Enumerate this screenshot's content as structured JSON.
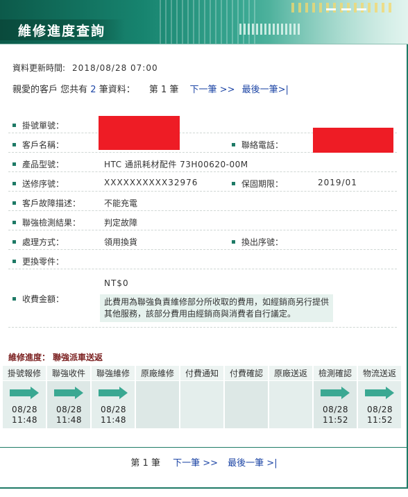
{
  "header": {
    "title": "維修進度查詢"
  },
  "update": {
    "label": "資料更新時間:",
    "value": "2018/08/28 07:00"
  },
  "summary": {
    "prefix": "親愛的客戶 您共有",
    "count": "2",
    "suffix": "筆資料：",
    "page": "第 1 筆",
    "next": "下一筆 >>",
    "last": "最後一筆>|"
  },
  "fields": {
    "ticket_no": {
      "label": "掛號單號："
    },
    "customer_name": {
      "label": "客戶名稱："
    },
    "phone": {
      "label": "聯絡電話："
    },
    "model": {
      "label": "產品型號：",
      "value": "HTC 通訊耗材配件 73H00620-00M"
    },
    "serial": {
      "label": "送修序號：",
      "value": "XXXXXXXXXX32976"
    },
    "warranty": {
      "label": "保固期限：",
      "value": "2019/01"
    },
    "fault": {
      "label": "客戶故障描述：",
      "value": "不能充電"
    },
    "inspection": {
      "label": "聯強檢測結果：",
      "value": "判定故障"
    },
    "handling": {
      "label": "處理方式：",
      "value": "領用換貨"
    },
    "swap_serial": {
      "label": "換出序號："
    },
    "parts": {
      "label": "更換零件："
    },
    "fee": {
      "label": "收費金額：",
      "amount": "NT$0",
      "note_line1": "此費用為聯強負責維修部分所收取的費用，如經銷商另行提供",
      "note_line2": "其他服務，該部分費用由經銷商與消費者自行議定。"
    }
  },
  "progress": {
    "title": "維修進度：",
    "status": "聯強派車送返",
    "steps": [
      {
        "label": "掛號報修",
        "date": "08/28",
        "time": "11:48",
        "done": true
      },
      {
        "label": "聯強收件",
        "date": "08/28",
        "time": "11:48",
        "done": true
      },
      {
        "label": "聯強維修",
        "date": "08/28",
        "time": "11:48",
        "done": true
      },
      {
        "label": "原廠維修",
        "date": "",
        "time": "",
        "done": false
      },
      {
        "label": "付費通知",
        "date": "",
        "time": "",
        "done": false
      },
      {
        "label": "付費確認",
        "date": "",
        "time": "",
        "done": false
      },
      {
        "label": "原廠送返",
        "date": "",
        "time": "",
        "done": false
      },
      {
        "label": "檢測確認",
        "date": "08/28",
        "time": "11:52",
        "done": true
      },
      {
        "label": "物流送返",
        "date": "08/28",
        "time": "11:52",
        "done": true
      }
    ]
  },
  "footer": {
    "page": "第 1 筆",
    "next": "下一筆 >>",
    "last": "最後一筆 >|"
  },
  "colors": {
    "accent": "#1e7a66",
    "link": "#1f47a6",
    "redaction": "#ee1c25",
    "arrow": "#3aa892"
  }
}
